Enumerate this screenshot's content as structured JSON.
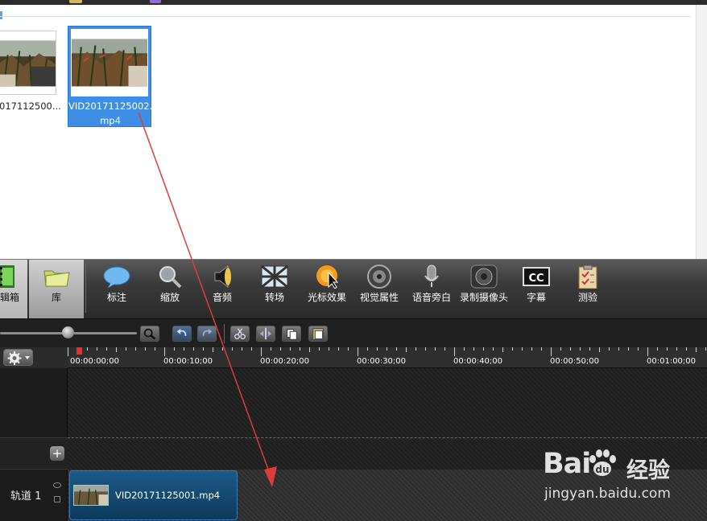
{
  "clip_bin": {
    "items": [
      {
        "name": "VID20171125001.mp4",
        "display_line1": "017112500...",
        "display_line2": "",
        "selected": false
      },
      {
        "name": "VID20171125002.mp4",
        "display_line1": "VID20171125002.",
        "display_line2": "mp4",
        "selected": true
      }
    ]
  },
  "tasks": [
    {
      "id": "clip-bin",
      "label": "编辑箱",
      "visible_label": "辑箱",
      "icon": "film-strip-icon",
      "active": true
    },
    {
      "id": "library",
      "label": "库",
      "icon": "folder-icon",
      "active": false
    },
    {
      "id": "callouts",
      "label": "标注",
      "icon": "speech-bubble-icon",
      "active": false
    },
    {
      "id": "zoom",
      "label": "缩放",
      "icon": "magnifier-icon",
      "active": false
    },
    {
      "id": "audio",
      "label": "音频",
      "icon": "speaker-icon",
      "active": false
    },
    {
      "id": "transitions",
      "label": "转场",
      "icon": "transition-icon",
      "active": false
    },
    {
      "id": "cursor-effects",
      "label": "光标效果",
      "icon": "cursor-effect-icon",
      "active": false
    },
    {
      "id": "visual-properties",
      "label": "视觉属性",
      "icon": "visual-properties-icon",
      "active": false
    },
    {
      "id": "voice-narration",
      "label": "语音旁白",
      "icon": "microphone-icon",
      "active": false
    },
    {
      "id": "record-camera",
      "label": "录制摄像头",
      "icon": "webcam-icon",
      "active": false
    },
    {
      "id": "captions",
      "label": "字幕",
      "icon": "cc-icon",
      "active": false
    },
    {
      "id": "quiz",
      "label": "测验",
      "icon": "clipboard-icon",
      "active": false
    }
  ],
  "timeline_toolbar": {
    "buttons": [
      {
        "id": "zoom-in",
        "icon": "magnifier-icon"
      },
      {
        "id": "undo",
        "icon": "undo-icon"
      },
      {
        "id": "redo",
        "icon": "redo-icon"
      },
      {
        "id": "cut",
        "icon": "scissors-icon"
      },
      {
        "id": "split",
        "icon": "split-icon"
      },
      {
        "id": "copy",
        "icon": "copy-icon"
      },
      {
        "id": "paste",
        "icon": "paste-icon"
      }
    ]
  },
  "ruler": {
    "labels": [
      "00:00:00;00",
      "00:00:10;00",
      "00:00:20;00",
      "00:00:30;00",
      "00:00:40;00",
      "00:00:50;00",
      "00:01:00;00"
    ]
  },
  "tracks": [
    {
      "name": "轨道 1",
      "clip": "VID20171125001.mp4"
    }
  ],
  "watermark": {
    "logo_left": "Bai",
    "logo_right": "经验",
    "url": "jingyan.baidu.com"
  },
  "colors": {
    "selection": "#3d8ee4",
    "clip": "#1c5a86",
    "arrow": "#e03b3b",
    "playhead": "#dd3333"
  }
}
